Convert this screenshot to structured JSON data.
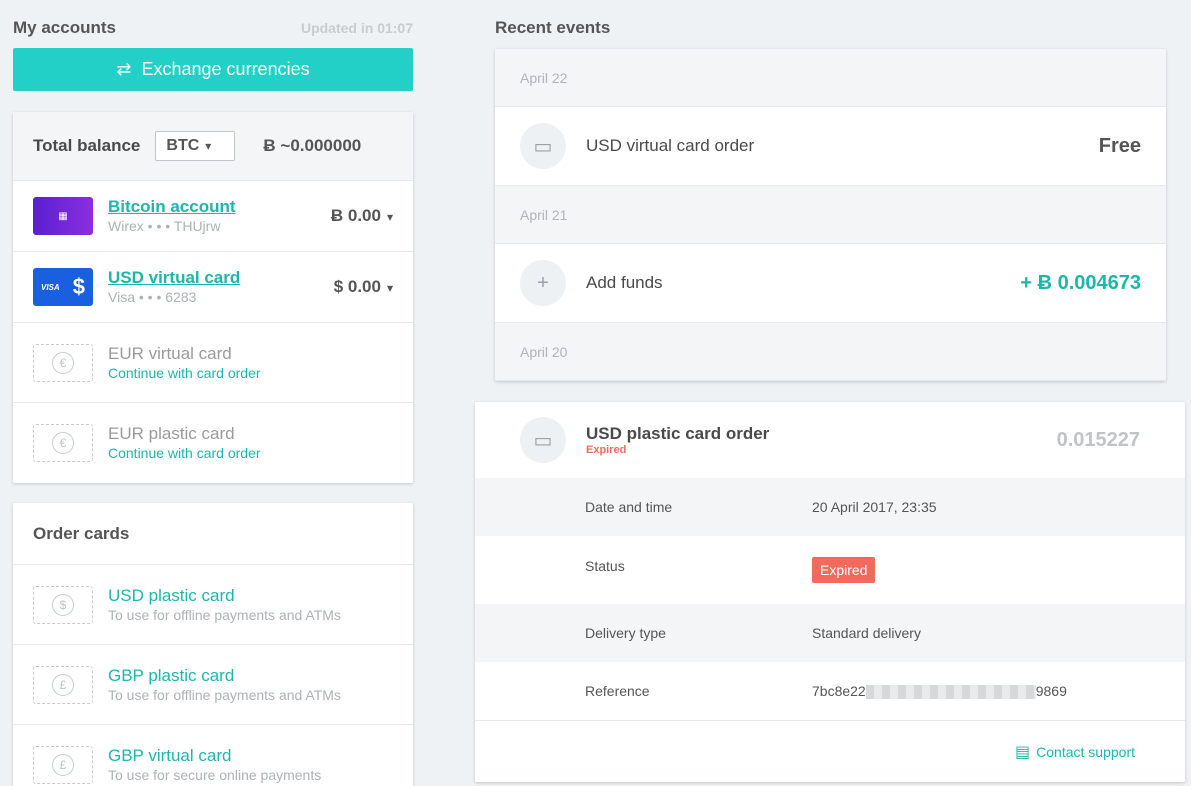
{
  "accounts": {
    "title": "My accounts",
    "updated": "Updated in 01:07",
    "exchange_label": "Exchange currencies",
    "exchange_icon": "exchange-icon",
    "total_label": "Total balance",
    "currency": "BTC",
    "total_value": "Ƀ ~0.000000",
    "items": [
      {
        "name": "Bitcoin account",
        "sub": "Wirex • • • THUjrw",
        "amount": "Ƀ 0.00"
      },
      {
        "name": "USD virtual card",
        "sub": "Visa • • • 6283",
        "amount": "$ 0.00",
        "visa": "VISA",
        "dollar": "$"
      },
      {
        "name": "EUR virtual card",
        "sub": "Continue with card order",
        "coin": "€"
      },
      {
        "name": "EUR plastic card",
        "sub": "Continue with card order",
        "coin": "€"
      }
    ]
  },
  "orders": {
    "title": "Order cards",
    "items": [
      {
        "name": "USD plastic card",
        "sub": "To use for offline payments and ATMs",
        "coin": "$"
      },
      {
        "name": "GBP plastic card",
        "sub": "To use for offline payments and ATMs",
        "coin": "£"
      },
      {
        "name": "GBP virtual card",
        "sub": "To use for secure online payments",
        "coin": "£"
      }
    ]
  },
  "events": {
    "title": "Recent events",
    "dates": [
      "April 22",
      "April 21",
      "April 20"
    ],
    "items": [
      {
        "label": "USD virtual card order",
        "amount": "Free",
        "icon": "card-icon"
      },
      {
        "label": "Add funds",
        "amount": "+ Ƀ 0.004673",
        "icon": "plus-icon"
      }
    ]
  },
  "detail": {
    "title": "USD plastic card order",
    "status_small": "Expired",
    "amount": "0.015227",
    "rows": [
      {
        "key": "Date and time",
        "value": "20 April 2017, 23:35"
      },
      {
        "key": "Status",
        "value": "Expired"
      },
      {
        "key": "Delivery type",
        "value": "Standard delivery"
      },
      {
        "key": "Reference",
        "value_start": "7bc8e22",
        "value_end": "9869"
      }
    ],
    "support_label": "Contact support"
  },
  "colors": {
    "accent": "#22d0c8",
    "teal_text": "#1cb7ac",
    "expired": "#f16a5d"
  }
}
